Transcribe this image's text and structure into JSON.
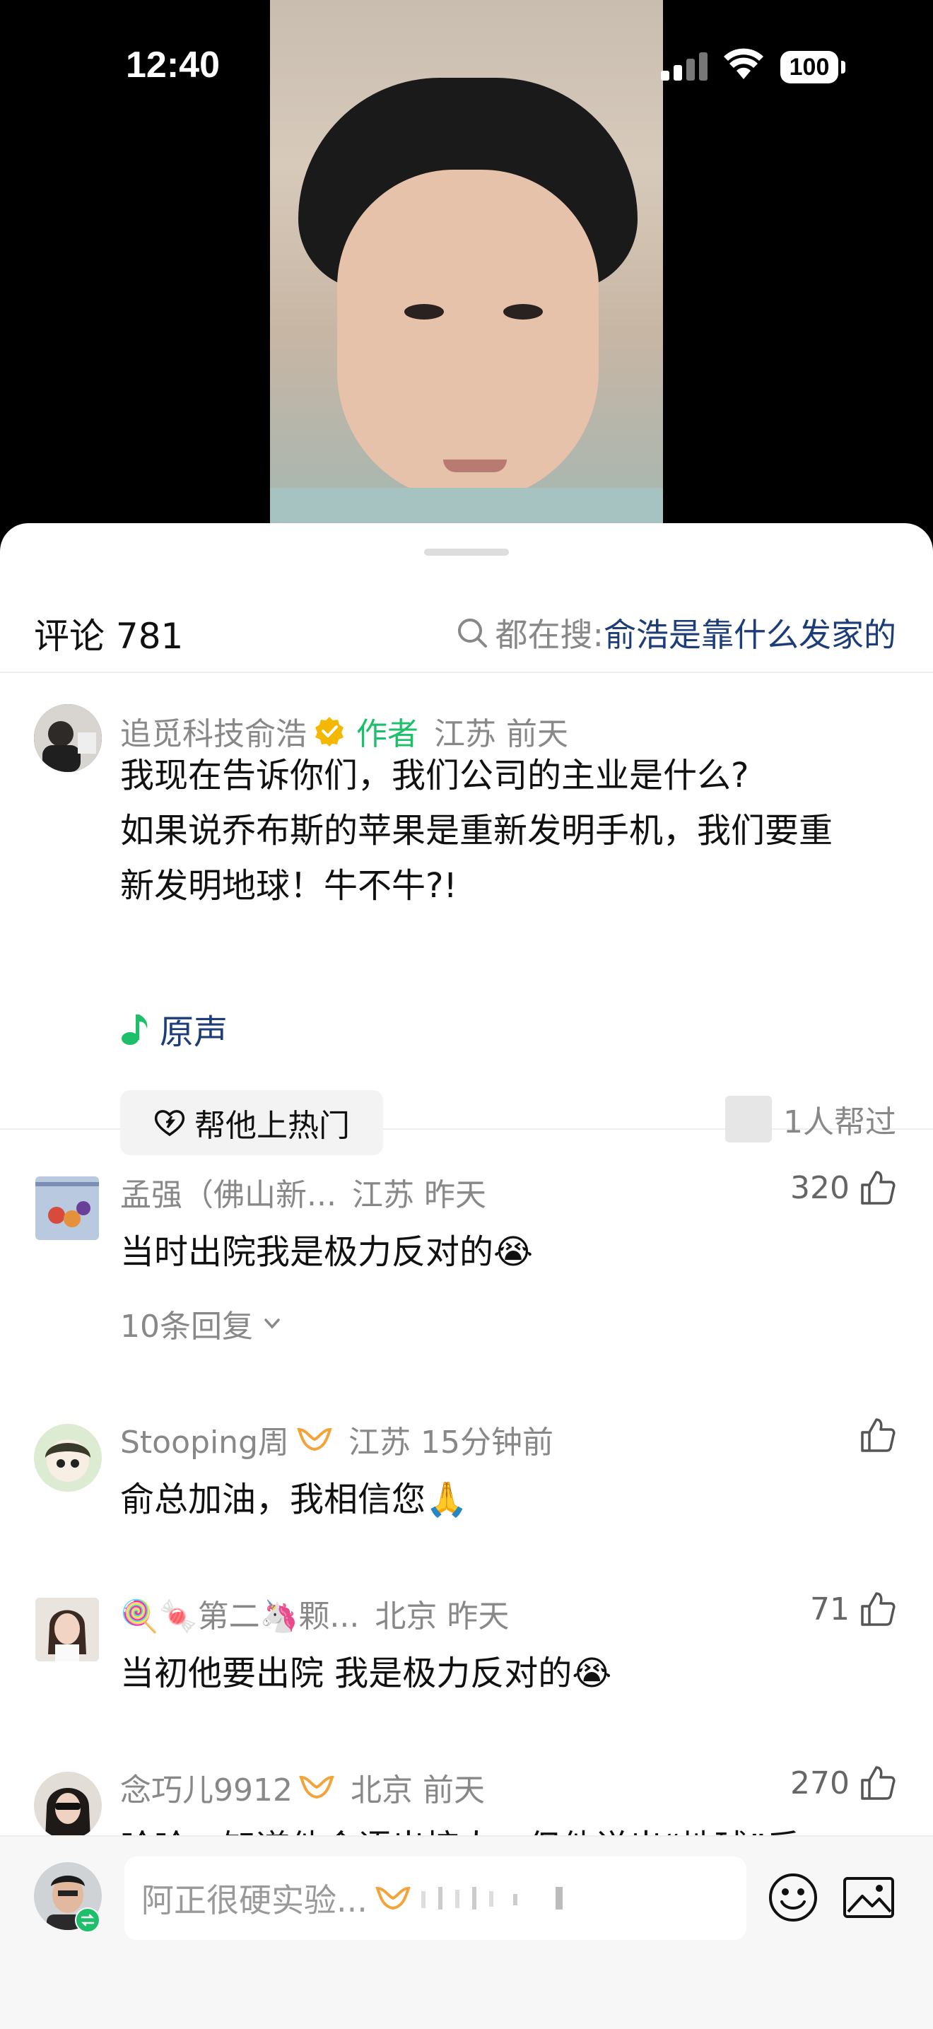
{
  "status_bar": {
    "time": "12:40",
    "battery": "100"
  },
  "header": {
    "title": "评论 781",
    "search_prefix": "都在搜:",
    "search_query": "俞浩是靠什么发家的"
  },
  "pinned_comment": {
    "username": "追觅科技俞浩",
    "author_tag": "作者",
    "meta": "江苏 前天",
    "lines": [
      "我现在告诉你们，我们公司的主业是什么?",
      "如果说乔布斯的苹果是重新发明手机，我们要重",
      "新发明地球！牛不牛?!"
    ],
    "music_label": "原声",
    "hot_button_label": "帮他上热门",
    "helped_label": "1人帮过"
  },
  "comments": [
    {
      "username": "孟强（佛山新...",
      "meta": "江苏 昨天",
      "text": "当时出院我是极力反对的😭",
      "likes": "320",
      "replies": "10条回复"
    },
    {
      "username": "Stooping周",
      "meta": "江苏 15分钟前",
      "text": "俞总加油，我相信您🙏",
      "likes": ""
    },
    {
      "username": "🍭🍬第二🦄颗...",
      "meta": "北京 昨天",
      "text": "当初他要出院 我是极力反对的😭",
      "likes": "71"
    },
    {
      "username": "念巧儿9912",
      "meta": "北京 前天",
      "text": "哈哈，知道他会语出惊人，但他说出“地球”后",
      "likes": "270"
    }
  ],
  "input": {
    "placeholder": "阿正很硬实验..."
  },
  "colors": {
    "author_green": "#1dbf6a",
    "link_blue": "#1d3d78",
    "vip_orange": "#f2a33a",
    "verified_gold": "#f5b800"
  }
}
